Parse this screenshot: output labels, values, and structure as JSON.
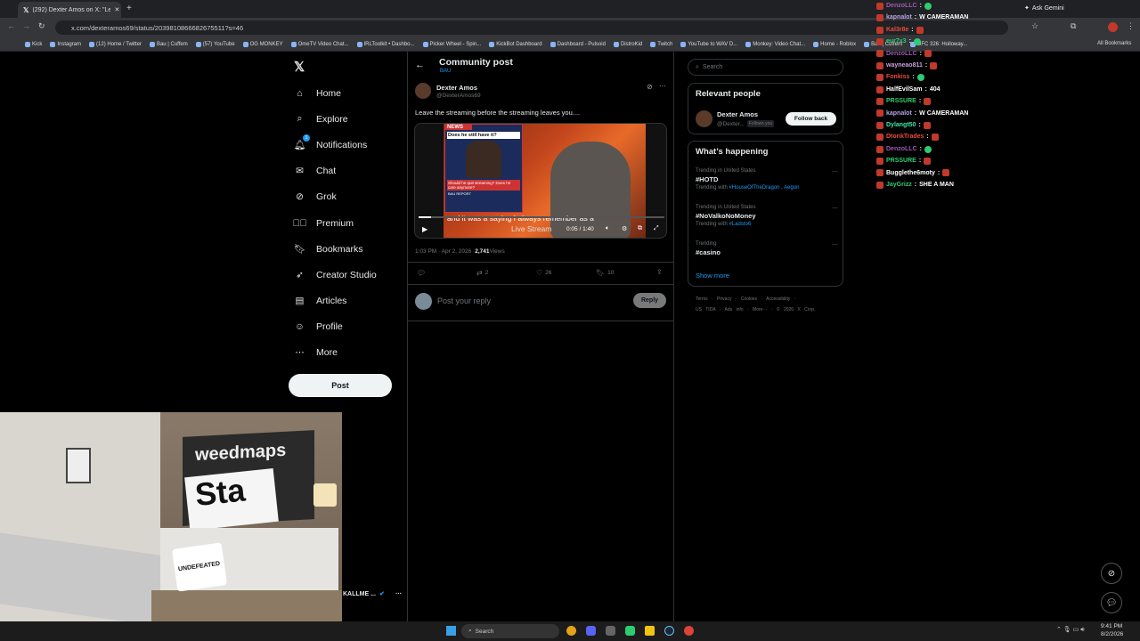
{
  "browser": {
    "tab_title": "(292) Dexter Amos on X: \"Leave",
    "url": "x.com/dexteramos69/status/2039810866682675511?s=46",
    "ask_gemini": "Ask Gemini",
    "bookmarks": [
      "Kick",
      "Instagram",
      "(12) Home / Twitter",
      "Bau | Cuffem",
      "(57) YouTube",
      "OG MONKEY",
      "OmeTV Video Chat...",
      "IRLToolkit • Dashbo...",
      "Picker Wheel - Spin...",
      "KickBot Dashboard",
      "Dashboard - Pulsoid",
      "DistroKid",
      "Twitch",
      "YouTube to WAV D...",
      "Monkey: Video Chat...",
      "Home - Roblox",
      "Bau | Cuffem",
      "UFC 326: Holloway..."
    ],
    "all_bookmarks": "All Bookmarks"
  },
  "nav": {
    "items": [
      "Home",
      "Explore",
      "Notifications",
      "Chat",
      "Grok",
      "Premium",
      "Bookmarks",
      "Creator Studio",
      "Articles",
      "Profile",
      "More"
    ],
    "post_label": "Post",
    "notif_badge": "1"
  },
  "post": {
    "header_title": "Community post",
    "header_sub": "BAU",
    "author_name": "Dexter Amos",
    "author_handle": "@DexterAmos69",
    "text": "Leave the streaming before the streaming leaves you....",
    "video_caption": "and it was a saying I always remember as a",
    "video_overlay": "Live Stream",
    "video_time": "0:05 / 1:40",
    "video_badge_top": "NEWS",
    "video_question": "Does he still have it?",
    "video_lower": "Should he quit streaming? Does he care anymore?",
    "video_ticker": "BAU REPORT",
    "timestamp": "1:03 PM · Apr 2, 2026 · ",
    "views_count": "2,741",
    "views_label": " Views",
    "reposts": "2",
    "likes": "26",
    "bookmarks": "10",
    "reply_placeholder": "Post your reply",
    "reply_button": "Reply"
  },
  "side": {
    "search_placeholder": "Search",
    "relevant_title": "Relevant people",
    "rel_name": "Dexter Amos",
    "rel_handle": "@Dexter...",
    "rel_follows": "Follows you",
    "follow_back": "Follow back",
    "happening_title": "What’s happening",
    "trends": [
      {
        "ctx": "Trending in United States",
        "name": "#HOTD",
        "with_label": "Trending with ",
        "with": "#HouseOfTheDragon , Aegon"
      },
      {
        "ctx": "Trending in United States",
        "name": "#NoValkoNoMoney",
        "with_label": "Trending with ",
        "with": "#Ladsto6"
      },
      {
        "ctx": "Trending",
        "name": "#casino",
        "with_label": "",
        "with": ""
      }
    ],
    "show_more": "Show more",
    "footer1": "Terms · Privacy · Cookies · Accessibility ·",
    "footer2": "US TIDA · Ads info · More··· · © 2026 X Corp."
  },
  "profile_stub": {
    "name": "KALLME ..."
  },
  "chat": [
    {
      "user": "DenzoLLC",
      "color": "#9b59b6",
      "msg": ""
    },
    {
      "user": "kapnalot",
      "color": "#b9a3e3",
      "msg": "W CAMERAMAN"
    },
    {
      "user": "Kal3r8e",
      "color": "#e74c3c",
      "msg": ""
    },
    {
      "user": "eur7x3",
      "color": "#2ecc71",
      "msg": ""
    },
    {
      "user": "DenzoLLC",
      "color": "#9b59b6",
      "msg": ""
    },
    {
      "user": "wayneao811",
      "color": "#c9a0dc",
      "msg": ""
    },
    {
      "user": "Fonkiss",
      "color": "#e74c3c",
      "msg": ""
    },
    {
      "user": "HalfEvilSam",
      "color": "#ffffff",
      "msg": "404"
    },
    {
      "user": "PRSSURE",
      "color": "#2ecc71",
      "msg": ""
    },
    {
      "user": "kapnalot",
      "color": "#b9a3e3",
      "msg": "W CAMERAMAN"
    },
    {
      "user": "Dylangt50",
      "color": "#3ce9a6",
      "msg": ""
    },
    {
      "user": "DtonkTrades",
      "color": "#e74c3c",
      "msg": ""
    },
    {
      "user": "DenzoLLC",
      "color": "#9b59b6",
      "msg": ""
    },
    {
      "user": "PRSSURE",
      "color": "#2ecc71",
      "msg": ""
    },
    {
      "user": "Bugglethe6moty",
      "color": "#ffffff",
      "msg": ""
    },
    {
      "user": "JayGrizz",
      "color": "#2ecc71",
      "msg": "SHE A MAN"
    }
  ],
  "taskbar": {
    "search": "Search",
    "time": "9:41 PM",
    "date": "8/2/2026"
  },
  "webcam": {
    "banner": "weedmaps",
    "sign": "Sta",
    "bag": "UNDEFEATED"
  }
}
